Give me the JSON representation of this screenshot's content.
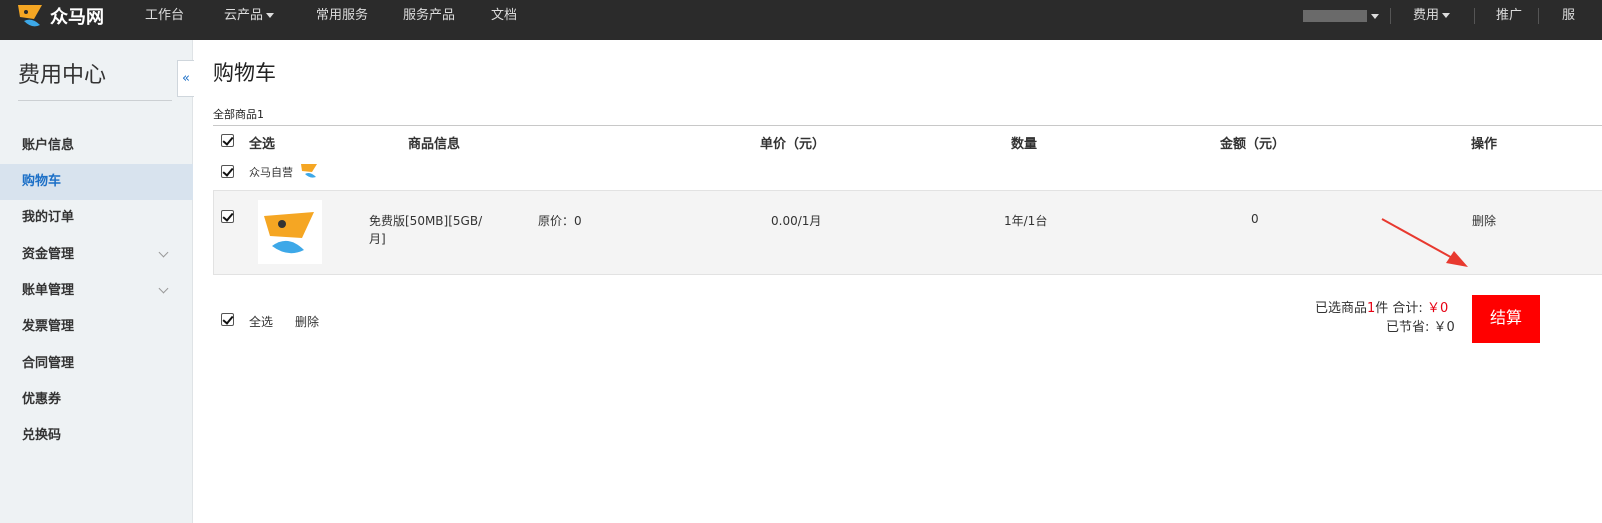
{
  "topbar": {
    "logo_text": "众马网",
    "nav": [
      "工作台",
      "云产品",
      "常用服务",
      "服务产品",
      "文档"
    ],
    "fees_label": "费用",
    "promote_label": "推广",
    "cutoff_label": "服"
  },
  "sidebar": {
    "title": "费用中心",
    "collapse_glyph": "«",
    "items": [
      {
        "label": "账户信息"
      },
      {
        "label": "购物车"
      },
      {
        "label": "我的订单"
      },
      {
        "label": "资金管理"
      },
      {
        "label": "账单管理"
      },
      {
        "label": "发票管理"
      },
      {
        "label": "合同管理"
      },
      {
        "label": "优惠券"
      },
      {
        "label": "兑换码"
      }
    ],
    "active_index": 1
  },
  "cart": {
    "title": "购物车",
    "all_count_label": "全部商品1",
    "headers": {
      "select_all": "全选",
      "product_info": "商品信息",
      "unit_price": "单价（元）",
      "quantity": "数量",
      "amount": "金额（元）",
      "action": "操作"
    },
    "shop_name": "众马自营",
    "item": {
      "name": "免费版[50MB][5GB/月]",
      "original_price": "原价：0",
      "unit_price": "0.00/1月",
      "quantity": "1年/1台",
      "amount": "0",
      "delete_label": "删除"
    },
    "footer": {
      "select_all": "全选",
      "delete_label": "删除",
      "selected_prefix": "已选商品",
      "selected_count": "1",
      "selected_suffix": "件  合计:",
      "total": "￥0",
      "saved_label": "已节省:",
      "saved": "￥0",
      "checkout_label": "结算"
    }
  },
  "colors": {
    "topbar_bg": "#2b2b2b",
    "accent_blue": "#1b6fc7",
    "checkout_red": "#ff0000",
    "price_red": "#e60012",
    "logo_orange": "#f5a623"
  }
}
